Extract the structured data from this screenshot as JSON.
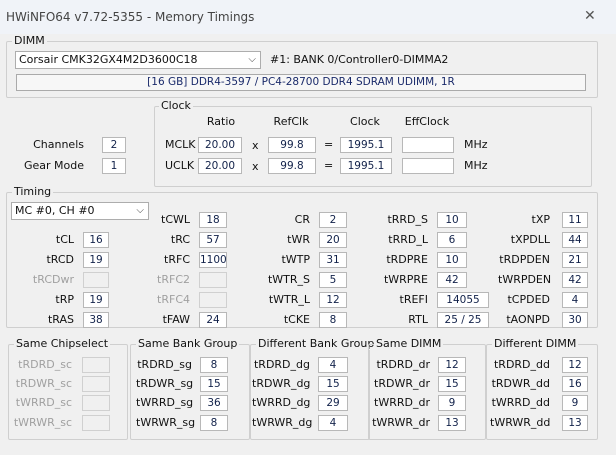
{
  "window": {
    "title": "HWiNFO64 v7.72-5355 - Memory Timings"
  },
  "dimm": {
    "group_label": "DIMM",
    "module": "Corsair CMK32GX4M2D3600C18",
    "slot": "#1: BANK 0/Controller0-DIMMA2",
    "info": "[16 GB] DDR4-3597 / PC4-28700 DDR4 SDRAM UDIMM, 1R"
  },
  "general": {
    "channels_label": "Channels",
    "channels": "2",
    "gear_label": "Gear Mode",
    "gear": "1"
  },
  "clock": {
    "group_label": "Clock",
    "headers": {
      "ratio": "Ratio",
      "refclk": "RefClk",
      "clock": "Clock",
      "effclock": "EffClock"
    },
    "mclk": {
      "label": "MCLK",
      "ratio": "20.00",
      "x": "x",
      "refclk": "99.8",
      "eq": "=",
      "clock": "1995.1",
      "eff": "",
      "unit": "MHz"
    },
    "uclk": {
      "label": "UCLK",
      "ratio": "20.00",
      "x": "x",
      "refclk": "99.8",
      "eq": "=",
      "clock": "1995.1",
      "eff": "",
      "unit": "MHz"
    }
  },
  "timing": {
    "group_label": "Timing",
    "channel_select": "MC #0, CH #0",
    "col1": [
      {
        "label": "tCL",
        "value": "16"
      },
      {
        "label": "tRCD",
        "value": "19"
      },
      {
        "label": "tRCDwr",
        "value": "",
        "disabled": true
      },
      {
        "label": "tRP",
        "value": "19"
      },
      {
        "label": "tRAS",
        "value": "38"
      }
    ],
    "col2": [
      {
        "label": "tCWL",
        "value": "18"
      },
      {
        "label": "tRC",
        "value": "57"
      },
      {
        "label": "tRFC",
        "value": "1100"
      },
      {
        "label": "tRFC2",
        "value": "",
        "disabled": true
      },
      {
        "label": "tRFC4",
        "value": "",
        "disabled": true
      },
      {
        "label": "tFAW",
        "value": "24"
      }
    ],
    "col3": [
      {
        "label": "CR",
        "value": "2"
      },
      {
        "label": "tWR",
        "value": "20"
      },
      {
        "label": "tWTP",
        "value": "31"
      },
      {
        "label": "tWTR_S",
        "value": "5"
      },
      {
        "label": "tWTR_L",
        "value": "12"
      },
      {
        "label": "tCKE",
        "value": "8"
      }
    ],
    "col4": [
      {
        "label": "tRRD_S",
        "value": "10"
      },
      {
        "label": "tRRD_L",
        "value": "6"
      },
      {
        "label": "tRDPRE",
        "value": "10"
      },
      {
        "label": "tWRPRE",
        "value": "42"
      },
      {
        "label": "tREFI",
        "value": "14055"
      },
      {
        "label": "RTL",
        "value": "25 / 25"
      }
    ],
    "col5": [
      {
        "label": "tXP",
        "value": "11"
      },
      {
        "label": "tXPDLL",
        "value": "44"
      },
      {
        "label": "tRDPDEN",
        "value": "21"
      },
      {
        "label": "tWRPDEN",
        "value": "42"
      },
      {
        "label": "tCPDED",
        "value": "4"
      },
      {
        "label": "tAONPD",
        "value": "30"
      }
    ]
  },
  "turnaround": {
    "same_chipselect": {
      "title": "Same Chipselect",
      "rows": [
        {
          "label": "tRDRD_sc",
          "value": "",
          "disabled": true
        },
        {
          "label": "tRDWR_sc",
          "value": "",
          "disabled": true
        },
        {
          "label": "tWRRD_sc",
          "value": "",
          "disabled": true
        },
        {
          "label": "tWRWR_sc",
          "value": "",
          "disabled": true
        }
      ]
    },
    "same_bank_group": {
      "title": "Same Bank Group",
      "rows": [
        {
          "label": "tRDRD_sg",
          "value": "8"
        },
        {
          "label": "tRDWR_sg",
          "value": "15"
        },
        {
          "label": "tWRRD_sg",
          "value": "36"
        },
        {
          "label": "tWRWR_sg",
          "value": "8"
        }
      ]
    },
    "different_bank_group": {
      "title": "Different Bank Group",
      "rows": [
        {
          "label": "tRDRD_dg",
          "value": "4"
        },
        {
          "label": "tRDWR_dg",
          "value": "15"
        },
        {
          "label": "tWRRD_dg",
          "value": "29"
        },
        {
          "label": "tWRWR_dg",
          "value": "4"
        }
      ]
    },
    "same_dimm": {
      "title": "Same DIMM",
      "rows": [
        {
          "label": "tRDRD_dr",
          "value": "12"
        },
        {
          "label": "tRDWR_dr",
          "value": "15"
        },
        {
          "label": "tWRRD_dr",
          "value": "9"
        },
        {
          "label": "tWRWR_dr",
          "value": "13"
        }
      ]
    },
    "different_dimm": {
      "title": "Different DIMM",
      "rows": [
        {
          "label": "tRDRD_dd",
          "value": "12"
        },
        {
          "label": "tRDWR_dd",
          "value": "16"
        },
        {
          "label": "tWRRD_dd",
          "value": "9"
        },
        {
          "label": "tWRWR_dd",
          "value": "13"
        }
      ]
    }
  }
}
